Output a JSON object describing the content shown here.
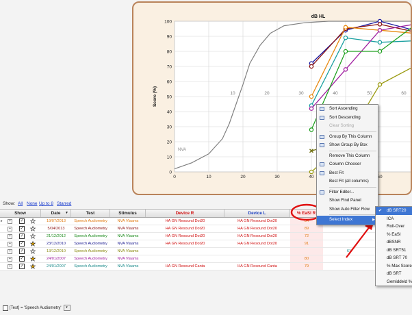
{
  "chart": {
    "title": "dB HL",
    "y_label": "Score (%)",
    "x_label": "SNR",
    "nva_label": "NVA"
  },
  "chart_data": {
    "type": "line",
    "title": "dB HL",
    "ylabel": "Score (%)",
    "y_ticks": [
      "100",
      "90",
      "80",
      "70",
      "60",
      "50",
      "40",
      "30",
      "20",
      "10",
      "0"
    ],
    "x_ticks_bottom": [
      "0",
      "10",
      "20",
      "30",
      "40",
      "50",
      "60",
      "70"
    ],
    "x_ticks_top": [
      "10",
      "20",
      "30",
      "40",
      "50",
      "60"
    ],
    "grid": true,
    "series": [
      {
        "color": "#808080",
        "style": "reference-curve",
        "values": [
          [
            0,
            2
          ],
          [
            5,
            6
          ],
          [
            10,
            12
          ],
          [
            14,
            22
          ],
          [
            16,
            32
          ],
          [
            18,
            45
          ],
          [
            20,
            58
          ],
          [
            22,
            72
          ],
          [
            25,
            84
          ],
          [
            28,
            92
          ],
          [
            32,
            97
          ],
          [
            38,
            99
          ],
          [
            45,
            100
          ],
          [
            60,
            100
          ],
          [
            75,
            100
          ]
        ]
      },
      {
        "color": "#1a1aa0",
        "marker": "circle",
        "values": [
          [
            40,
            72
          ],
          [
            50,
            94
          ],
          [
            60,
            100
          ],
          [
            70,
            94
          ]
        ]
      },
      {
        "color": "#8a1010",
        "marker": "circle",
        "values": [
          [
            40,
            70
          ],
          [
            50,
            95
          ],
          [
            60,
            98
          ],
          [
            70,
            93
          ]
        ]
      },
      {
        "color": "#e88a10",
        "marker": "circle",
        "values": [
          [
            40,
            50
          ],
          [
            50,
            96
          ],
          [
            60,
            94
          ],
          [
            70,
            92
          ]
        ]
      },
      {
        "color": "#1aa0a0",
        "marker": "circle",
        "values": [
          [
            40,
            44
          ],
          [
            50,
            89
          ],
          [
            60,
            86
          ],
          [
            70,
            87
          ]
        ]
      },
      {
        "color": "#a020a0",
        "marker": "circle",
        "values": [
          [
            40,
            42
          ],
          [
            50,
            68
          ],
          [
            60,
            94
          ],
          [
            70,
            98
          ]
        ]
      },
      {
        "color": "#20a020",
        "marker": "circle",
        "values": [
          [
            40,
            28
          ],
          [
            50,
            80
          ],
          [
            60,
            80
          ],
          [
            70,
            97
          ]
        ]
      },
      {
        "color": "#707010",
        "marker": "x",
        "values": [
          [
            40,
            14
          ],
          [
            50,
            20
          ]
        ]
      },
      {
        "color": "#9a9a10",
        "marker": "circle",
        "values": [
          [
            40,
            0
          ],
          [
            50,
            20
          ],
          [
            60,
            58
          ],
          [
            70,
            70
          ]
        ]
      }
    ]
  },
  "toolbar": {
    "show_label": "Show:",
    "all": "All",
    "none": "None",
    "up_to_8": "Up to 8",
    "starred": "Starred"
  },
  "grid": {
    "columns": [
      "Show",
      "Date",
      "Test",
      "Stimulus",
      "Device R",
      "Device L",
      "% EaSI R"
    ],
    "rows": [
      {
        "date": "19/07/2013",
        "test": "Speech Audiometry",
        "stimulus": "NVA Vlaams",
        "device_r": "HA GN Resound Dot20",
        "device_l": "HA GN Resound Dot20",
        "val1": "",
        "val2": "84",
        "val3": "",
        "color": "#e07a10",
        "starred": false,
        "current": true
      },
      {
        "date": "5/04/2013",
        "test": "Speech Audiometry",
        "stimulus": "NVA Vlaams",
        "device_r": "HA GN Resound Dot20",
        "device_l": "HA GN Resound Dot20",
        "val1": "",
        "val2": "89",
        "val3": "",
        "color": "#8a1010",
        "starred": false,
        "current": false
      },
      {
        "date": "21/12/2012",
        "test": "Speech Audiometry",
        "stimulus": "NVA Vlaams",
        "device_r": "HA GN Resound Dot20",
        "device_l": "HA GN Resound Dot20",
        "val1": "",
        "val2": "72",
        "val3": "",
        "color": "#1a8a1a",
        "starred": false,
        "current": false
      },
      {
        "date": "23/12/2010",
        "test": "Speech Audiometry",
        "stimulus": "NVA Vlaams",
        "device_r": "HA GN Resound Dot20",
        "device_l": "HA GN Resound Dot20",
        "val1": "",
        "val2": "91",
        "val3": "",
        "color": "#1a1a90",
        "starred": true,
        "current": false
      },
      {
        "date": "13/12/2010",
        "test": "Speech Audiometry",
        "stimulus": "NVA Vlaams",
        "device_r": "",
        "device_l": "",
        "val1": "41",
        "val2": "",
        "val3": "61",
        "color": "#8a8a10",
        "starred": false,
        "current": false
      },
      {
        "date": "24/01/2007",
        "test": "Speech Audiometry",
        "stimulus": "NVA Vlaams",
        "device_r": "",
        "device_l": "",
        "val1": "",
        "val2": "80",
        "val3": "",
        "color": "#a020a0",
        "starred": true,
        "current": false
      },
      {
        "date": "24/01/2007",
        "test": "Speech Audiometry",
        "stimulus": "NVA Vlaams",
        "device_r": "HA GN Resound Canta",
        "device_l": "HA GN Resound Canta",
        "val1": "",
        "val2": "79",
        "val3": "",
        "color": "#1a8a8a",
        "starred": true,
        "current": false
      }
    ]
  },
  "context_menu": {
    "items": [
      {
        "label": "Sort Ascending",
        "icon": "sort-ascending-icon",
        "disabled": false
      },
      {
        "label": "Sort Descending",
        "icon": "sort-descending-icon",
        "disabled": false
      },
      {
        "label": "Clear Sorting",
        "icon": "",
        "disabled": true
      },
      {
        "sep": true
      },
      {
        "label": "Group By This Column",
        "icon": "group-by-icon",
        "disabled": false
      },
      {
        "label": "Show Group By Box",
        "icon": "group-box-icon",
        "disabled": false
      },
      {
        "sep": true
      },
      {
        "label": "Remove This Column",
        "icon": "",
        "disabled": false
      },
      {
        "label": "Column Chooser",
        "icon": "column-chooser-icon",
        "disabled": false
      },
      {
        "label": "Best Fit",
        "icon": "best-fit-icon",
        "disabled": false
      },
      {
        "label": "Best Fit (all columns)",
        "icon": "",
        "disabled": false
      },
      {
        "sep": true
      },
      {
        "label": "Filter Editor...",
        "icon": "filter-icon",
        "disabled": false
      },
      {
        "label": "Show Find Panel",
        "icon": "",
        "disabled": false
      },
      {
        "label": "Show Auto Filter Row",
        "icon": "",
        "disabled": false
      },
      {
        "sep": true
      },
      {
        "label": "Select Index",
        "icon": "",
        "disabled": false,
        "selected": true
      }
    ]
  },
  "submenu": {
    "items": [
      "dB SRT20",
      "ICA",
      "Roll-Over",
      "% EaSI",
      "dBSNR",
      "dB SRT51",
      "dB SRT 70",
      "% Max Score",
      "dB SRT",
      "Gemiddeld %"
    ],
    "checked_index": 0
  },
  "filter": {
    "text": "[Test] = 'Speech Audiometry'"
  },
  "colors": {
    "annotation_red": "#e01010",
    "menu_highlight": "#3e76d3",
    "panel_border": "#b9835a",
    "panel_bg": "#faf0e2"
  }
}
